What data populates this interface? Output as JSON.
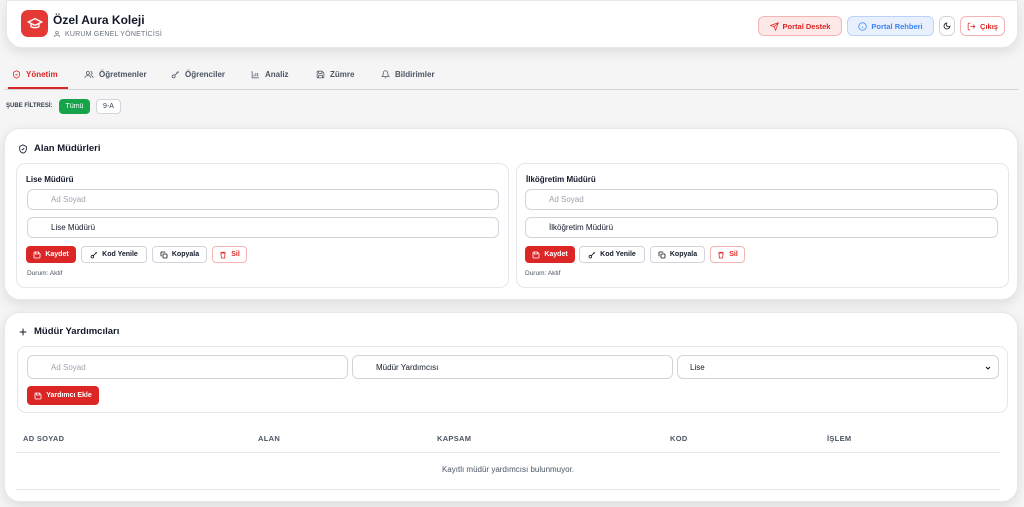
{
  "header": {
    "institution_name": "Özel Aura Koleji",
    "role": "KURUM GENEL YÖNETİCİSİ",
    "buttons": {
      "portal_support": "Portal Destek",
      "portal_guide": "Portal Rehberi",
      "logout": "Çıkış"
    },
    "icons": [
      "graduation-cap-icon",
      "user-icon",
      "send-icon",
      "info-icon",
      "moon-icon",
      "logout-icon"
    ]
  },
  "tabs": [
    {
      "label": "Yönetim",
      "icon": "shield-icon",
      "active": true
    },
    {
      "label": "Öğretmenler",
      "icon": "users-icon",
      "active": false
    },
    {
      "label": "Öğrenciler",
      "icon": "key-icon",
      "active": false
    },
    {
      "label": "Analiz",
      "icon": "bar-chart-icon",
      "active": false
    },
    {
      "label": "Zümre",
      "icon": "save-icon",
      "active": false
    },
    {
      "label": "Bildirimler",
      "icon": "bell-icon",
      "active": false
    }
  ],
  "filter": {
    "label": "ŞUBE FİLTRESİ:",
    "options": [
      {
        "label": "Tümü",
        "selected": true
      },
      {
        "label": "9-A",
        "selected": false
      }
    ]
  },
  "managers": {
    "title": "Alan Müdürleri",
    "cards": [
      {
        "title": "Lise Müdürü",
        "name_placeholder": "Ad Soyad",
        "position_value": "Lise Müdürü",
        "buttons": {
          "save": "Kaydet",
          "renew_code": "Kod Yenile",
          "copy": "Kopyala",
          "delete": "Sil"
        },
        "status": "Durum: Aktif"
      },
      {
        "title": "İlköğretim Müdürü",
        "name_placeholder": "Ad Soyad",
        "position_value": "İlköğretim Müdürü",
        "buttons": {
          "save": "Kaydet",
          "renew_code": "Kod Yenile",
          "copy": "Kopyala",
          "delete": "Sil"
        },
        "status": "Durum: Aktif"
      }
    ]
  },
  "assistants": {
    "title": "Müdür Yardımcıları",
    "form": {
      "name_placeholder": "Ad Soyad",
      "position_value": "Müdür Yardımcısı",
      "scope_selected": "Lise",
      "add_button": "Yardımcı Ekle"
    },
    "table": {
      "headers": [
        "AD SOYAD",
        "ALAN",
        "KAPSAM",
        "KOD",
        "İŞLEM"
      ],
      "empty_message": "Kayıtlı müdür yardımcısı bulunmuyor."
    }
  },
  "colors": {
    "accent": "#dc2626",
    "success": "#16a34a",
    "info": "#3b82f6"
  }
}
